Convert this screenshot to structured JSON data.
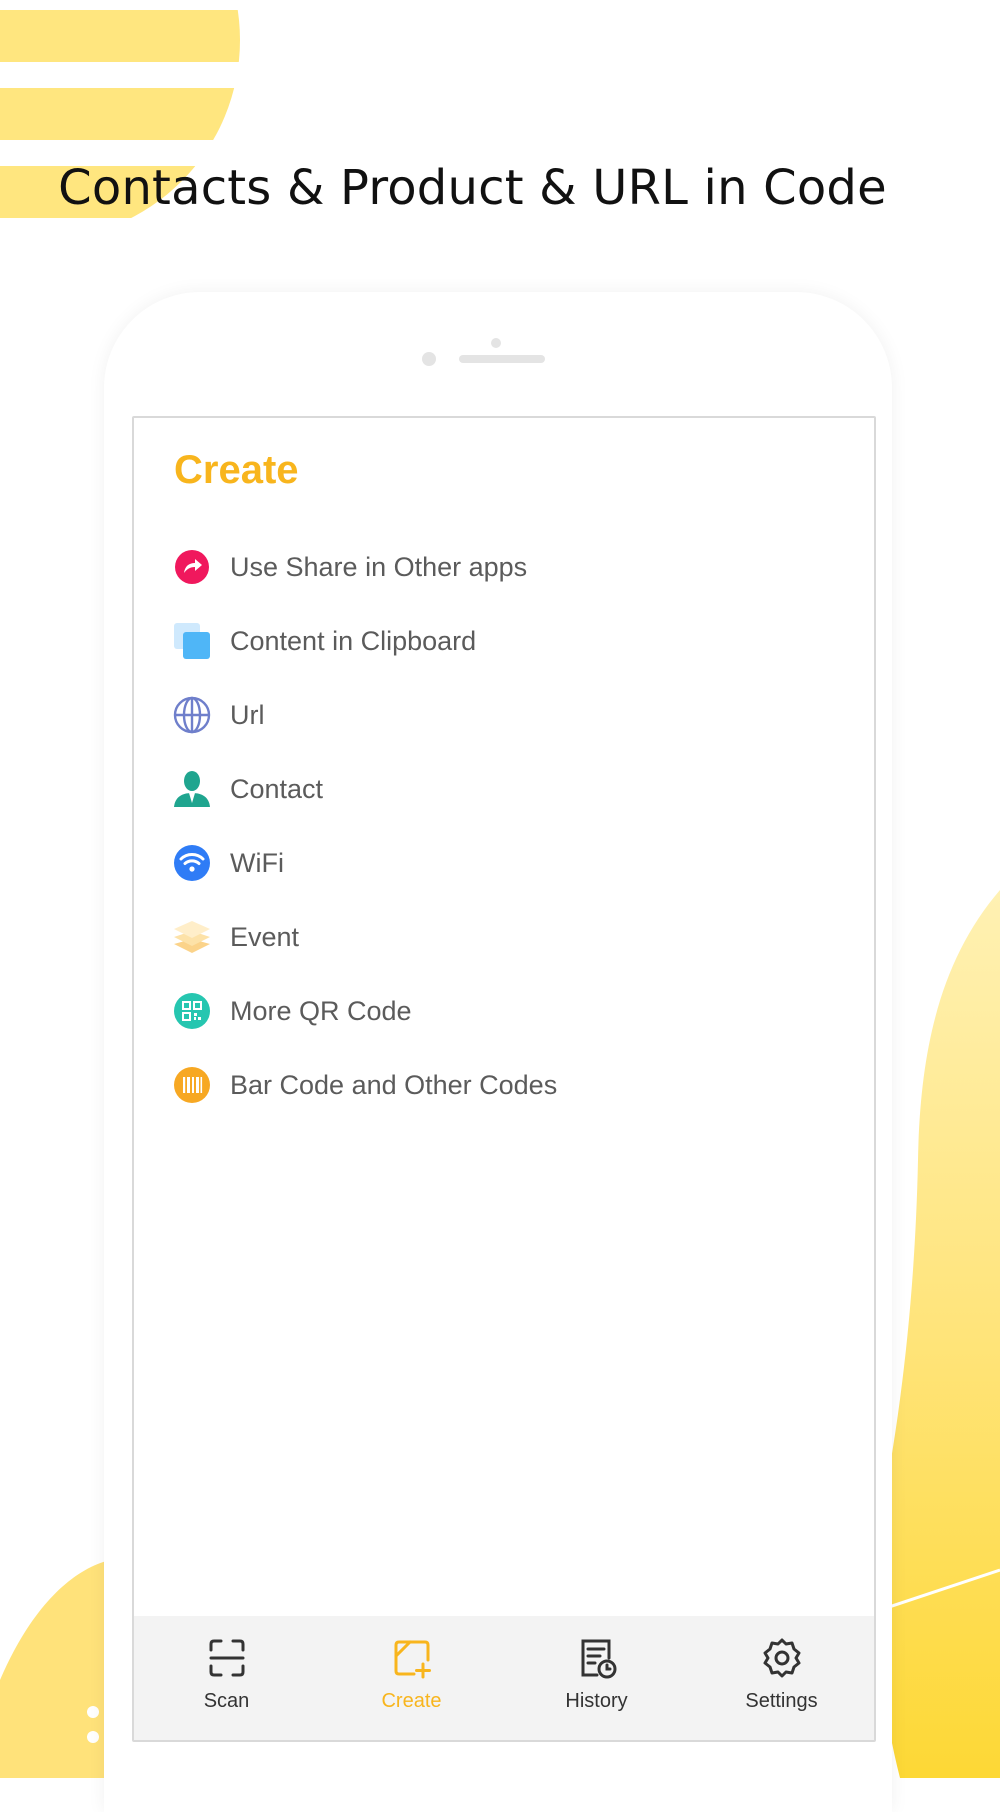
{
  "headline": "Contacts & Product & URL in Code",
  "colors": {
    "accent": "#f8b51d",
    "yellow_light": "#ffe27a",
    "yellow": "#fdd835",
    "text": "#5b5b5b"
  },
  "app": {
    "title": "Create",
    "menu": [
      {
        "label": "Use Share in Other apps",
        "icon": "share-icon"
      },
      {
        "label": "Content in Clipboard",
        "icon": "clipboard-icon"
      },
      {
        "label": "Url",
        "icon": "globe-icon"
      },
      {
        "label": "Contact",
        "icon": "contact-icon"
      },
      {
        "label": "WiFi",
        "icon": "wifi-icon"
      },
      {
        "label": "Event",
        "icon": "layers-icon"
      },
      {
        "label": "More QR Code",
        "icon": "qr-code-icon"
      },
      {
        "label": "Bar Code and Other Codes",
        "icon": "barcode-icon"
      }
    ],
    "tabs": [
      {
        "label": "Scan",
        "icon": "scan-icon",
        "active": false
      },
      {
        "label": "Create",
        "icon": "create-icon",
        "active": true
      },
      {
        "label": "History",
        "icon": "history-icon",
        "active": false
      },
      {
        "label": "Settings",
        "icon": "gear-icon",
        "active": false
      }
    ]
  }
}
